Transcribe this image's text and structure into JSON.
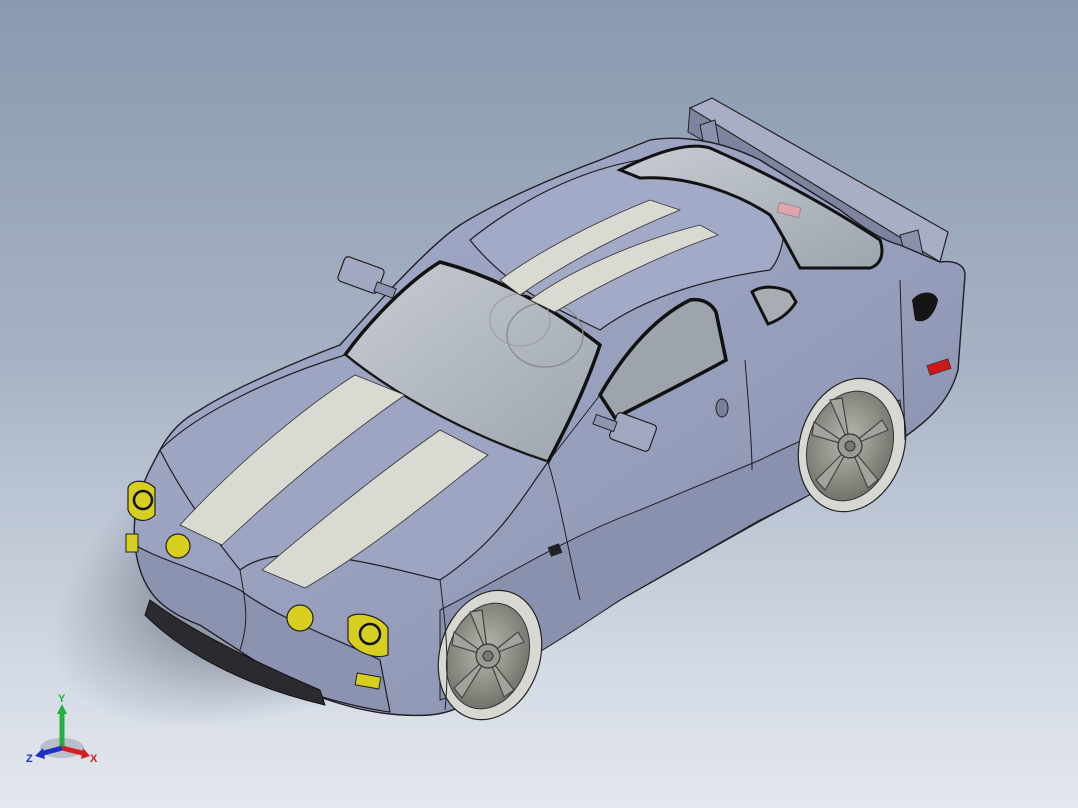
{
  "triad": {
    "x_label": "X",
    "y_label": "Y",
    "z_label": "Z",
    "x_color": "#d42020",
    "y_color": "#22b040",
    "z_color": "#2030c0"
  },
  "colors": {
    "body": "#9aa2c0",
    "stripe": "#d9dad2",
    "glass": "#b4bac2",
    "wheel": "#8d8d86",
    "lamp": "#d6cf1f",
    "reflector": "#d01818"
  }
}
